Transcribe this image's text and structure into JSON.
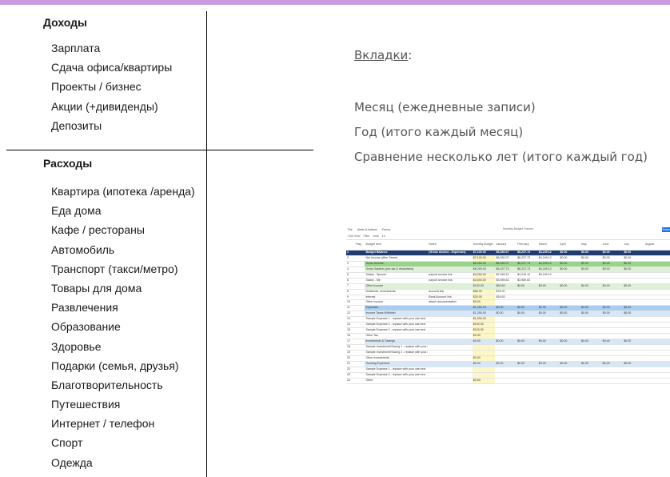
{
  "income": {
    "heading": "Доходы",
    "items": [
      "Зарплата",
      "Сдача офиса/квартиры",
      "Проекты / бизнес",
      "Акции (+дивиденды)",
      "Депозиты"
    ]
  },
  "expenses": {
    "heading": "Расходы",
    "items": [
      "Квартира (ипотека /аренда)",
      "Еда дома",
      "Кафе / рестораны",
      "Автомобиль",
      "Транспорт (такси/метро)",
      "Товары для дома",
      "Развлечения",
      "Образование",
      "Здоровье",
      "Подарки (семья, друзья)",
      "Благотворительность",
      "Путешествия",
      "Интернет / телефон",
      "Спорт",
      "Одежда"
    ]
  },
  "tabs": {
    "title": "Вкладки",
    "colon": ":",
    "items": [
      "Месяц (ежедневные записи)",
      "Год (итого каждый месяц)",
      "Сравнение несколько лет (итого каждый год)"
    ]
  },
  "sheet": {
    "menu": [
      "File",
      "Alerts & Actions",
      "Forms"
    ],
    "title": "Monthly Budget Tracker",
    "share": "Share",
    "toolbar": [
      "Grid View",
      "Filter",
      "Arial",
      "10"
    ],
    "columns": [
      "Flag",
      "Budget Item",
      "Notes",
      "Monthly Budget",
      "January",
      "February",
      "March",
      "April",
      "May",
      "June",
      "July",
      "August"
    ],
    "rows": [
      {
        "style": "balance",
        "item": "Budget Balance",
        "notes": "(Gross Income - Expenses)",
        "vals": [
          "$7,100.00",
          "$6,330.07",
          "$6,237.73",
          "$4,249.12",
          "$0.00",
          "$0.00",
          "$0.00",
          "$0.00"
        ]
      },
      {
        "style": "",
        "item": "Net Income (After Taxes)",
        "notes": "",
        "vals": [
          "$7,100.00",
          "$6,330.07",
          "$6,237.73",
          "$4,249.12",
          "$0.00",
          "$0.00",
          "$0.00",
          "$0.00"
        ]
      },
      {
        "style": "green",
        "item": "Gross Income",
        "notes": "",
        "vals": [
          "$8,350.00",
          "$6,330.07",
          "$6,237.73",
          "$4,249.12",
          "$0.00",
          "$0.00",
          "$0.00",
          "$0.00"
        ]
      },
      {
        "style": "lgreen",
        "item": "Gross Salaries (pre-tax & deductions)",
        "notes": "",
        "vals": [
          "$8,250.00",
          "$6,237.73",
          "$6,237.73",
          "$4,249.12",
          "$0.00",
          "$0.00",
          "$0.00",
          "$0.00"
        ]
      },
      {
        "style": "",
        "item": "Salary - Spouse",
        "notes": "payroll service link",
        "vals": [
          "$4,250.00",
          "$2,348.12",
          "$4,249.12",
          "$4,249.12",
          "",
          "",
          "",
          ""
        ]
      },
      {
        "style": "",
        "item": "Salary - Me",
        "notes": "payroll service link",
        "vals": [
          "$4,000.00",
          "$3,989.63",
          "$3,989.63",
          "",
          "",
          "",
          "",
          ""
        ]
      },
      {
        "style": "lgreen",
        "item": "Other Income",
        "notes": "",
        "vals": [
          "$100.00",
          "$92.63",
          "$0.00",
          "$0.00",
          "$0.00",
          "$0.00",
          "$0.00",
          "$0.00"
        ]
      },
      {
        "style": "",
        "item": "Dividends, Investments",
        "notes": "account link",
        "vals": [
          "$80.00",
          "$76.00",
          "",
          "",
          "",
          "",
          "",
          ""
        ]
      },
      {
        "style": "",
        "item": "Interest",
        "notes": "Bank Account link",
        "vals": [
          "$20.00",
          "$16.63",
          "",
          "",
          "",
          "",
          "",
          ""
        ]
      },
      {
        "style": "",
        "item": "Other Income",
        "notes": "attach documentation",
        "vals": [
          "$0.00",
          "",
          "",
          "",
          "",
          "",
          "",
          ""
        ]
      },
      {
        "style": "blue",
        "item": "Expenses",
        "notes": "",
        "vals": [
          "$1,250.00",
          "$0.00",
          "$0.00",
          "$0.00",
          "$0.00",
          "$0.00",
          "$0.00",
          "$0.00"
        ]
      },
      {
        "style": "lblue",
        "item": "Income Taxes Withheld",
        "notes": "",
        "vals": [
          "$1,250.00",
          "$0.00",
          "$0.00",
          "$0.00",
          "$0.00",
          "$0.00",
          "$0.00",
          "$0.00"
        ]
      },
      {
        "style": "",
        "item": "Sample Expense 1 - replace with your own text",
        "notes": "",
        "vals": [
          "$1,000.00",
          "",
          "",
          "",
          "",
          "",
          "",
          ""
        ]
      },
      {
        "style": "",
        "item": "Sample Expense 2 - replace with your own text",
        "notes": "",
        "vals": [
          "$100.00",
          "",
          "",
          "",
          "",
          "",
          "",
          ""
        ]
      },
      {
        "style": "",
        "item": "Sample Expense 3 - replace with your own text",
        "notes": "",
        "vals": [
          "$100.00",
          "",
          "",
          "",
          "",
          "",
          "",
          ""
        ]
      },
      {
        "style": "",
        "item": "Other Tax",
        "notes": "",
        "vals": [
          "$0.00",
          "",
          "",
          "",
          "",
          "",
          "",
          ""
        ]
      },
      {
        "style": "lblue",
        "item": "Investments & Savings",
        "notes": "",
        "vals": [
          "$0.00",
          "$0.00",
          "$0.00",
          "$0.00",
          "$0.00",
          "$0.00",
          "$0.00",
          "$0.00"
        ]
      },
      {
        "style": "",
        "item": "Sample Investment/Saving 1 - replace with your own text",
        "notes": "",
        "vals": [
          "",
          "",
          "",
          "",
          "",
          "",
          "",
          ""
        ]
      },
      {
        "style": "",
        "item": "Sample Investment/Saving 2 - replace with your own text",
        "notes": "",
        "vals": [
          "",
          "",
          "",
          "",
          "",
          "",
          "",
          ""
        ]
      },
      {
        "style": "",
        "item": "Other Investments",
        "notes": "",
        "vals": [
          "$0.00",
          "",
          "",
          "",
          "",
          "",
          "",
          ""
        ]
      },
      {
        "style": "lblue",
        "item": "Housing Expenses",
        "notes": "",
        "vals": [
          "$0.00",
          "$0.00",
          "$0.00",
          "$0.00",
          "$0.00",
          "$0.00",
          "$0.00",
          "$0.00"
        ]
      },
      {
        "style": "",
        "item": "Sample Expense 1 - replace with your own text",
        "notes": "",
        "vals": [
          "",
          "",
          "",
          "",
          "",
          "",
          "",
          ""
        ]
      },
      {
        "style": "",
        "item": "Sample Expense 2 - replace with your own text",
        "notes": "",
        "vals": [
          "",
          "",
          "",
          "",
          "",
          "",
          "",
          ""
        ]
      },
      {
        "style": "",
        "item": "Other",
        "notes": "",
        "vals": [
          "$0.00",
          "",
          "",
          "",
          "",
          "",
          "",
          ""
        ]
      }
    ]
  }
}
